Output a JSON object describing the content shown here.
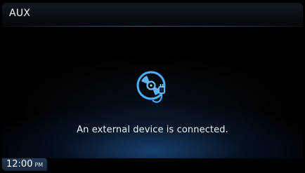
{
  "header": {
    "title": "AUX"
  },
  "main": {
    "icon": "disc-with-usb-plug-icon",
    "message": "An external device is connected."
  },
  "status_bar": {
    "time": "12:00",
    "ampm": "PM"
  },
  "colors": {
    "accent": "#3a9ae8",
    "background": "#000000",
    "text": "#ffffff"
  }
}
